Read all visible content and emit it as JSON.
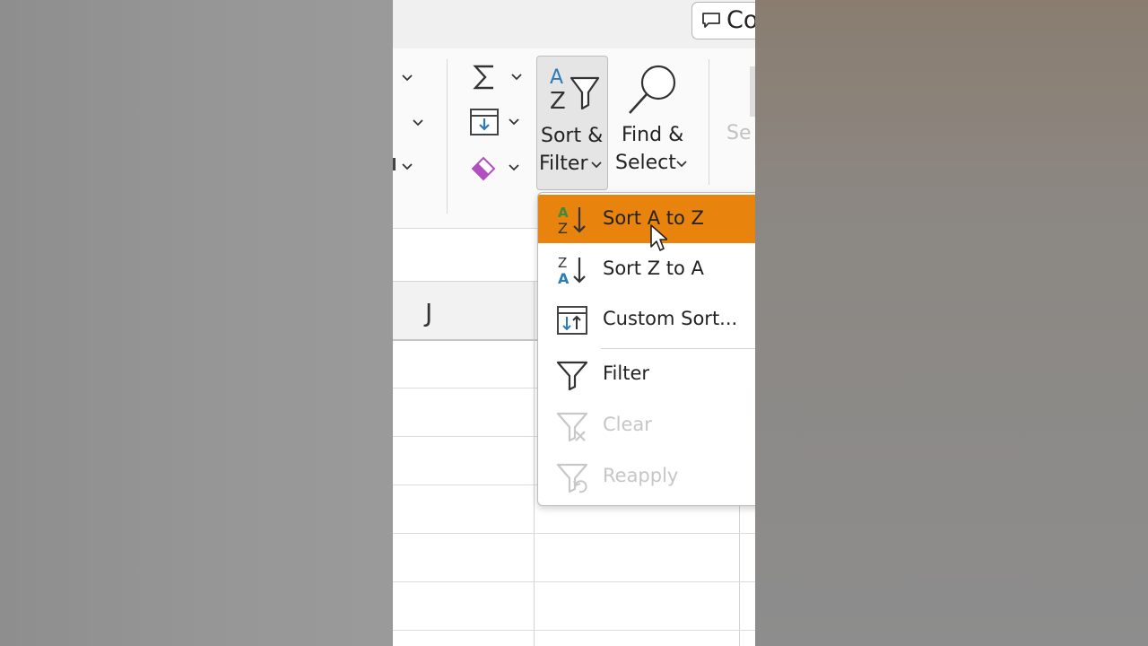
{
  "topbar": {
    "comments_label": "Co"
  },
  "ribbon": {
    "sort_filter": {
      "line1": "Sort &",
      "line2": "Filter"
    },
    "find_select": {
      "line1": "Find &",
      "line2": "Select"
    },
    "sensitivity_partial": "Se"
  },
  "grid": {
    "column_header": "J"
  },
  "sort_menu": {
    "items": [
      {
        "label": "Sort A to Z",
        "icon": "sort-a-to-z-icon",
        "highlighted": true,
        "enabled": true
      },
      {
        "label": "Sort Z to A",
        "icon": "sort-z-to-a-icon",
        "highlighted": false,
        "enabled": true
      },
      {
        "label": "Custom Sort...",
        "icon": "custom-sort-icon",
        "highlighted": false,
        "enabled": true
      },
      {
        "label": "Filter",
        "icon": "filter-icon",
        "highlighted": false,
        "enabled": true
      },
      {
        "label": "Clear",
        "icon": "clear-filter-icon",
        "highlighted": false,
        "enabled": false
      },
      {
        "label": "Reapply",
        "icon": "reapply-filter-icon",
        "highlighted": false,
        "enabled": false
      }
    ]
  },
  "colors": {
    "highlight": "#e8830e",
    "accent_blue": "#2b7bb9",
    "accent_green": "#3f8a3c",
    "eraser_purple": "#b04fbd"
  }
}
